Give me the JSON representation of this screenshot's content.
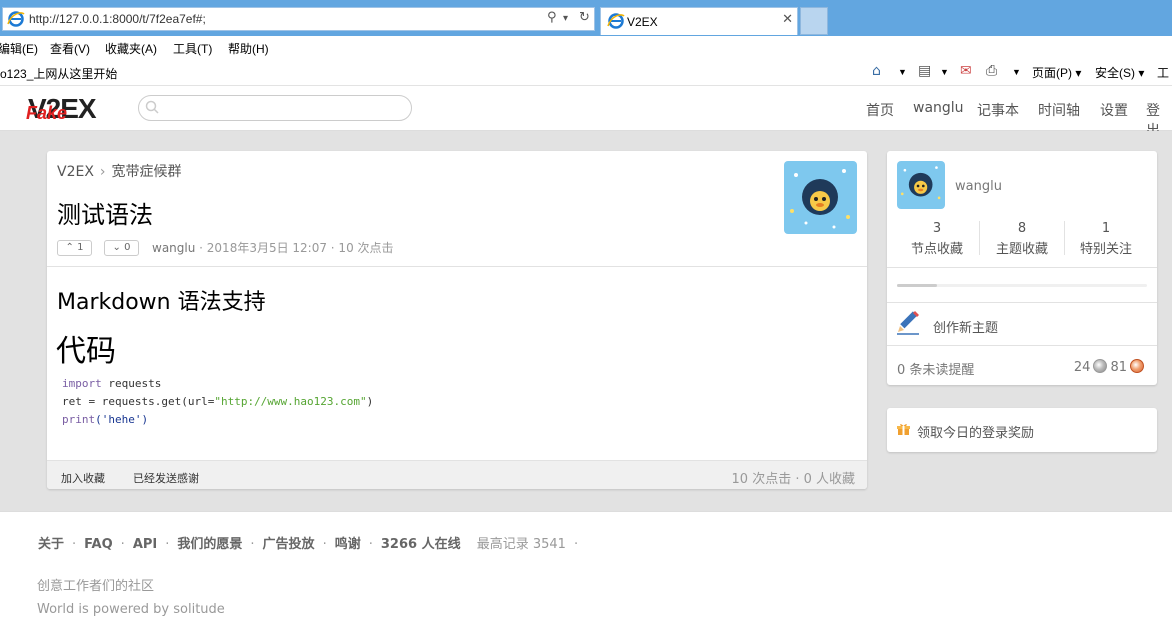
{
  "browser": {
    "address": "http://127.0.0.1:8000/t/7f2ea7ef#;",
    "tab_title": "V2EX",
    "menu": [
      "编辑(E)",
      "查看(V)",
      "收藏夹(A)",
      "工具(T)",
      "帮助(H)"
    ],
    "favorite": "o123_上网从这里开始",
    "commands": [
      "页面(P)",
      "安全(S)",
      "工"
    ]
  },
  "site": {
    "logo_fake": "Fake",
    "logo_main": "V2EX",
    "nav": [
      "首页",
      "wanglu",
      "记事本",
      "时间轴",
      "设置",
      "登出"
    ]
  },
  "topic": {
    "breadcrumb_root": "V2EX",
    "breadcrumb_sep": "›",
    "breadcrumb_node": "宽带症候群",
    "title": "测试语法",
    "up_votes": "1",
    "down_votes": "0",
    "author": "wanglu",
    "meta": " · 2018年3月5日 12:07 · 10 次点击",
    "content_h1": "Markdown 语法支持",
    "content_h2": "代码",
    "code_line1_kw": "import",
    "code_line1_rest": " requests",
    "code_line2_a": "ret = requests.get(url=",
    "code_line2_str": "\"http://www.hao123.com\"",
    "code_line2_b": ")",
    "code_line3_fn": "print",
    "code_line3_str": "('hehe')",
    "footer_fav": "加入收藏",
    "footer_thanks": "已经发送感谢",
    "footer_stats": "10 次点击 · 0 人收藏"
  },
  "sidebar": {
    "username": "wanglu",
    "stats": [
      {
        "num": "3",
        "label": "节点收藏"
      },
      {
        "num": "8",
        "label": "主题收藏"
      },
      {
        "num": "1",
        "label": "特别关注"
      }
    ],
    "progress": 0.16,
    "create": "创作新主题",
    "unread": "0 条未读提醒",
    "silver": "24",
    "bronze": "81",
    "daily": "领取今日的登录奖励"
  },
  "footer": {
    "links": [
      "关于",
      "FAQ",
      "API",
      "我们的愿景",
      "广告投放",
      "鸣谢"
    ],
    "online": "3266 人在线",
    "record": "最高记录 3541",
    "tagline": "创意工作者们的社区",
    "powered": "World is powered by solitude"
  },
  "colors": {
    "ie_blue": "#62a6e0",
    "page_bg": "#e2e2e2",
    "logo_red": "#e02020"
  }
}
